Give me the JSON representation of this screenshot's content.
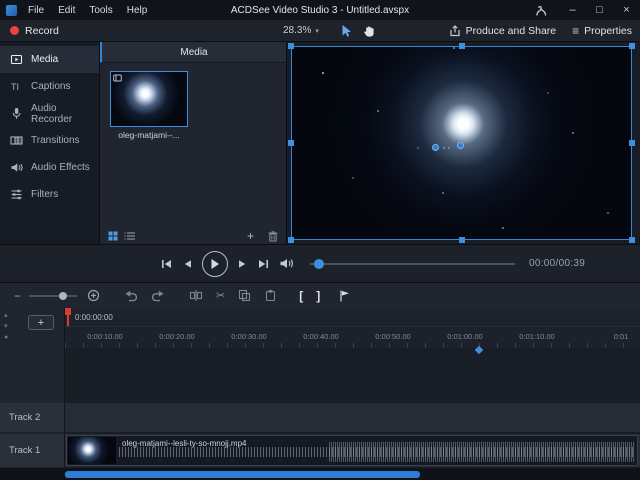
{
  "window": {
    "title": "ACDSee Video Studio 3 - Untitled.avspx",
    "menus": [
      "File",
      "Edit",
      "Tools",
      "Help"
    ],
    "controls": {
      "minimize": "–",
      "maximize": "□",
      "close": "×"
    }
  },
  "toolbar": {
    "record_label": "Record",
    "zoom_value": "28.3%",
    "produce_label": "Produce and Share",
    "properties_label": "Properties"
  },
  "sidebar": {
    "active": "Media",
    "items": [
      {
        "label": "Media"
      },
      {
        "label": "Captions"
      },
      {
        "label": "Audio Recorder"
      },
      {
        "label": "Transitions"
      },
      {
        "label": "Audio Effects"
      },
      {
        "label": "Filters"
      }
    ]
  },
  "media_panel": {
    "header": "Media",
    "item_label": "oleg-matjami--..."
  },
  "transport": {
    "timecode": "00:00/00:39"
  },
  "timeline": {
    "position_label": "0:00:00:00",
    "add_track_label": "+",
    "ruler_labels": [
      "0:00:10.00",
      "0:00:20.00",
      "0:00:30.00",
      "0:00:40.00",
      "0:00:50.00",
      "0:01:00.00",
      "0:01:10.00",
      "0:01"
    ],
    "tracks": [
      {
        "label": "Track 2"
      },
      {
        "label": "Track 1"
      }
    ],
    "clip_filename": "oleg-matjami--lesli-ty-so-mnojj.mp4"
  },
  "icons": {
    "chevron_down": "▾",
    "zoom_out": "−",
    "mark_in": "[",
    "mark_out": "]",
    "scissors": "✂",
    "properties_menu": "≡",
    "add": "+",
    "gutter_a": "▴",
    "gutter_b": "▾",
    "gutter_c": "●"
  },
  "colors": {
    "accent_blue": "#2f7fd6",
    "selection_blue": "#3f8fe0",
    "record_red": "#e8453c",
    "playhead_red": "#d83b32",
    "background_dark": "#181c25"
  }
}
